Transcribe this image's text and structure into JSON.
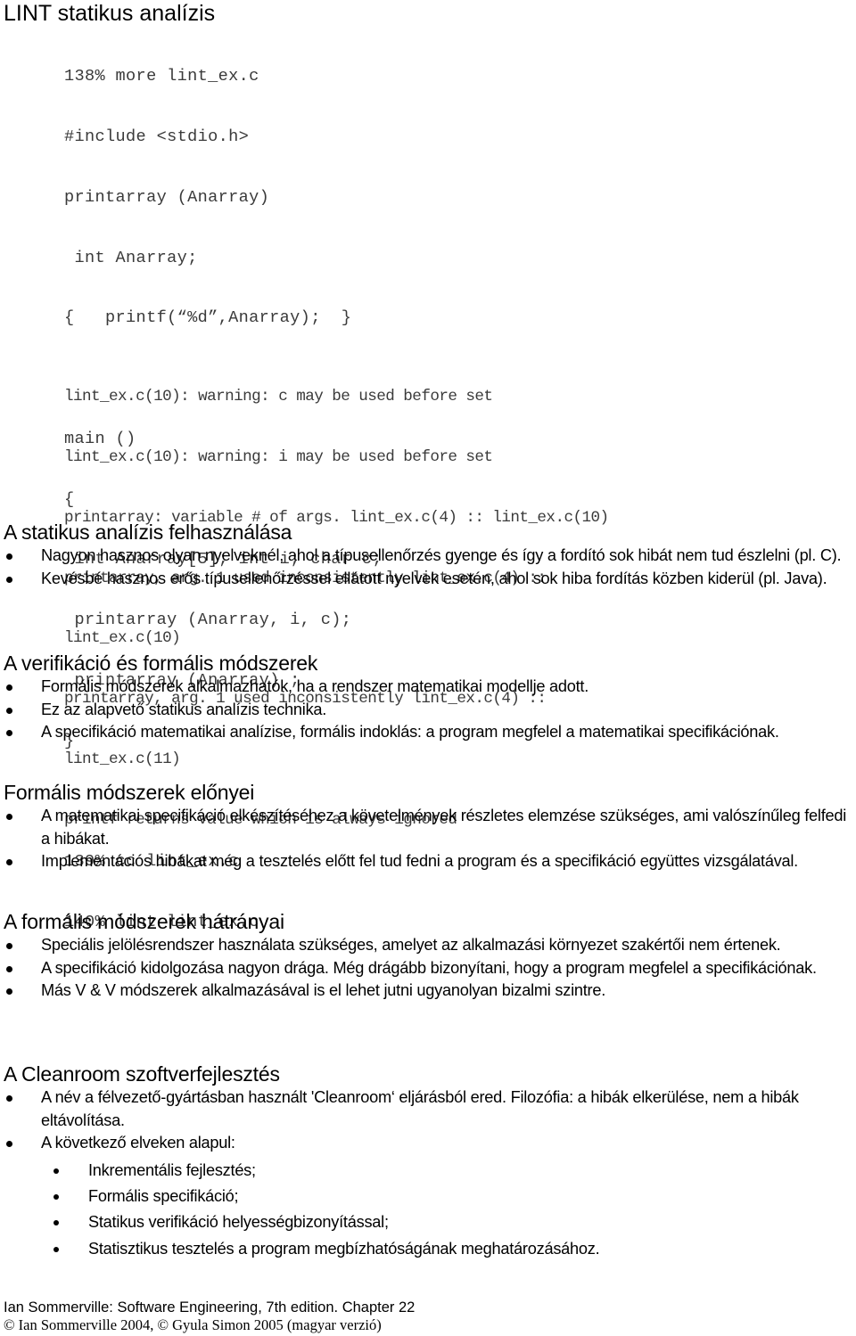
{
  "title": "LINT statikus analízis",
  "code_source": [
    "138% more lint_ex.c",
    "#include <stdio.h>",
    "printarray (Anarray)",
    " int Anarray;",
    "{   printf(“%d”,Anarray);  }",
    "",
    "main ()",
    "{",
    " int Anarray[5]; int i; char c;",
    " printarray (Anarray, i, c);",
    " printarray (Anarray) ;",
    "}",
    "",
    "139% cc lint_ex.c",
    "140% lint lint_ex.c"
  ],
  "code_output": [
    "lint_ex.c(10): warning: c may be used before set",
    "lint_ex.c(10): warning: i may be used before set",
    "printarray: variable # of args. lint_ex.c(4) :: lint_ex.c(10)",
    "printarray, arg. 1 used inconsistently lint_ex.c(4) ::",
    "lint_ex.c(10)",
    "printarray, arg. 1 used inconsistently lint_ex.c(4) ::",
    "lint_ex.c(11)",
    "printf returns value which is always ignored"
  ],
  "sections": [
    {
      "heading": "A statikus analízis felhasználása",
      "items": [
        "Nagyon hasznos olyan nyelveknél, ahol a típusellenőrzés gyenge és így a fordító sok hibát nem tud észlelni (pl. C).",
        "Kevésbé hasznos erős típusellenőrzéssel ellátott nyelvek esetén, ahol sok hiba fordítás közben kiderül (pl. Java)."
      ]
    },
    {
      "heading": "A verifikáció és formális módszerek",
      "items": [
        "Formális módszerek alkalmazhatók, ha a rendszer matematikai modellje adott.",
        "Ez az alapvető statikus analízis technika.",
        "A specifikáció matematikai analízise, formális indoklás: a program megfelel a matematikai specifikációnak."
      ]
    },
    {
      "heading": "Formális módszerek előnyei",
      "items": [
        "A matematikai specifikáció elkészítéséhez a követelmények részletes elemzése szükséges, ami valószínűleg felfedi a hibákat.",
        "Implementációs hibákat még a tesztelés előtt fel tud fedni a program és a specifikáció együttes vizsgálatával."
      ]
    },
    {
      "heading": "A formális módszerek hátrányai",
      "items": [
        "Speciális jelölésrendszer használata szükséges, amelyet az alkalmazási környezet szakértői nem értenek.",
        "A specifikáció kidolgozása nagyon drága. Még drágább bizonyítani, hogy a program megfelel a specifikációnak.",
        "Más V & V módszerek alkalmazásával is el lehet jutni ugyanolyan bizalmi szintre."
      ]
    },
    {
      "heading": "A Cleanroom szoftverfejlesztés",
      "items": [
        "A név a félvezető-gyártásban használt 'Cleanroom‘ eljárásból ered. Filozófia: a hibák elkerülése, nem a hibák eltávolítása.",
        "A következő elveken alapul:"
      ],
      "sub_items": [
        "Inkrementális fejlesztés;",
        "Formális specifikáció;",
        "Statikus verifikáció helyességbizonyítással;",
        "Statisztikus tesztelés a program megbízhatóságának meghatározásához."
      ]
    }
  ],
  "footer": {
    "line1": "Ian Sommerville: Software Engineering, 7th edition. Chapter 22",
    "line2": "© Ian Sommerville 2004, © Gyula Simon 2005 (magyar verzió)"
  }
}
